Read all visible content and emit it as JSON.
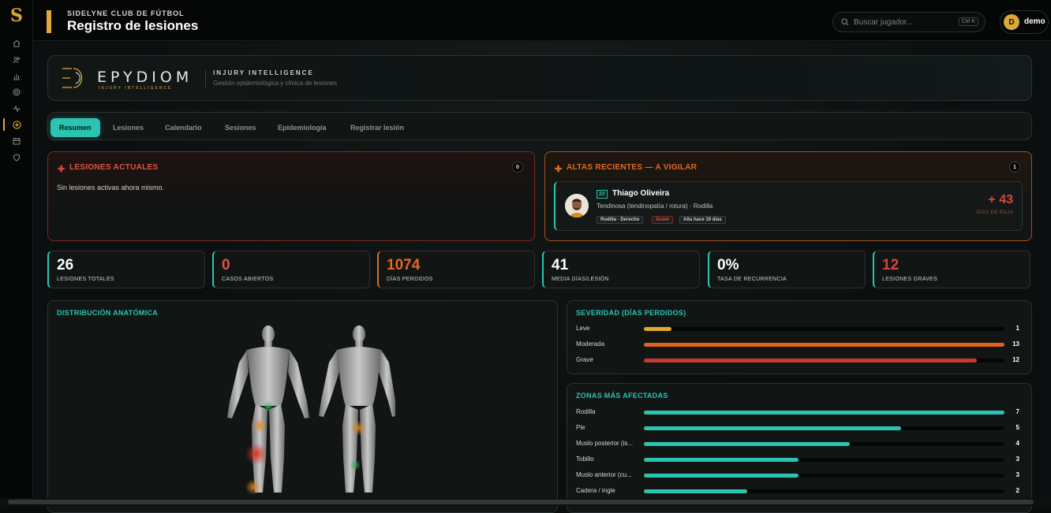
{
  "header": {
    "club": "SIDELYNE CLUB DE FÚTBOL",
    "title": "Registro de lesiones",
    "search_placeholder": "Buscar jugador...",
    "search_shortcut": "Ctrl K",
    "user_initial": "D",
    "user_name": "demo"
  },
  "sidebar": {
    "items": [
      "home-icon",
      "users-icon",
      "bar-chart-icon",
      "target-icon",
      "activity-icon",
      "injury-icon",
      "calendar-icon",
      "shield-icon"
    ],
    "active_index": 5
  },
  "brand": {
    "wordmark": "EPYDIOM",
    "wordmark_sub": "INJURY INTELLIGENCE",
    "tagline": "INJURY INTELLIGENCE",
    "description": "Gestión epidemiológica y clínica de lesiones"
  },
  "tabs": [
    {
      "label": "Resumen",
      "active": true
    },
    {
      "label": "Lesiones",
      "active": false
    },
    {
      "label": "Calendario",
      "active": false
    },
    {
      "label": "Sesiones",
      "active": false
    },
    {
      "label": "Epidemiología",
      "active": false
    },
    {
      "label": "Registrar lesión",
      "active": false
    }
  ],
  "current_injuries": {
    "title": "LESIONES ACTUALES",
    "count": "0",
    "empty_text": "Sin lesiones activas ahora mismo."
  },
  "recent_discharges": {
    "title": "ALTAS RECIENTES — A VIGILAR",
    "count": "1",
    "player": {
      "number": "20",
      "name": "Thiago Oliveira",
      "description": "Tendinosa (tendinopatía / rotura) · Rodilla",
      "chips": [
        "Rodilla · Derecho",
        "Grave",
        "Alta hace 19 días"
      ],
      "days_value": "+ 43",
      "days_label": "DÍAS DE BAJA"
    }
  },
  "stats": [
    {
      "value": "26",
      "label": "LESIONES TOTALES",
      "color": "#ffffff",
      "accent": "#2bc4b0"
    },
    {
      "value": "0",
      "label": "CASOS ABIERTOS",
      "color": "#e0533f",
      "accent": "#2bc4b0"
    },
    {
      "value": "1074",
      "label": "DÍAS PERDIDOS",
      "color": "#e06a1e",
      "accent": "#e06a1e"
    },
    {
      "value": "41",
      "label": "MEDIA DÍAS/LESIÓN",
      "color": "#ffffff",
      "accent": "#2bc4b0"
    },
    {
      "value": "0%",
      "label": "TASA DE RECURRENCIA",
      "color": "#ffffff",
      "accent": "#2bc4b0"
    },
    {
      "value": "12",
      "label": "LESIONES GRAVES",
      "color": "#d8453a",
      "accent": "#2bc4b0"
    }
  ],
  "anatomy": {
    "title": "DISTRIBUCIÓN ANATÓMICA"
  },
  "severity": {
    "title": "SEVERIDAD (DÍAS PERDIDOS)",
    "rows": [
      {
        "label": "Leve",
        "value": 1,
        "fraction": 0.077,
        "color": "#e0a930"
      },
      {
        "label": "Moderada",
        "value": 13,
        "fraction": 1.0,
        "color": "#e0621e"
      },
      {
        "label": "Grave",
        "value": 12,
        "fraction": 0.923,
        "color": "#c83a30"
      }
    ]
  },
  "zones": {
    "title": "ZONAS MÁS AFECTADAS",
    "rows": [
      {
        "label": "Rodilla",
        "value": 7,
        "fraction": 1.0
      },
      {
        "label": "Pie",
        "value": 5,
        "fraction": 0.714
      },
      {
        "label": "Muslo posterior (is...",
        "value": 4,
        "fraction": 0.571
      },
      {
        "label": "Tobillo",
        "value": 3,
        "fraction": 0.429
      },
      {
        "label": "Muslo anterior (cu...",
        "value": 3,
        "fraction": 0.429
      },
      {
        "label": "Cadera / ingle",
        "value": 2,
        "fraction": 0.286
      }
    ],
    "color": "#2bc4b0"
  }
}
